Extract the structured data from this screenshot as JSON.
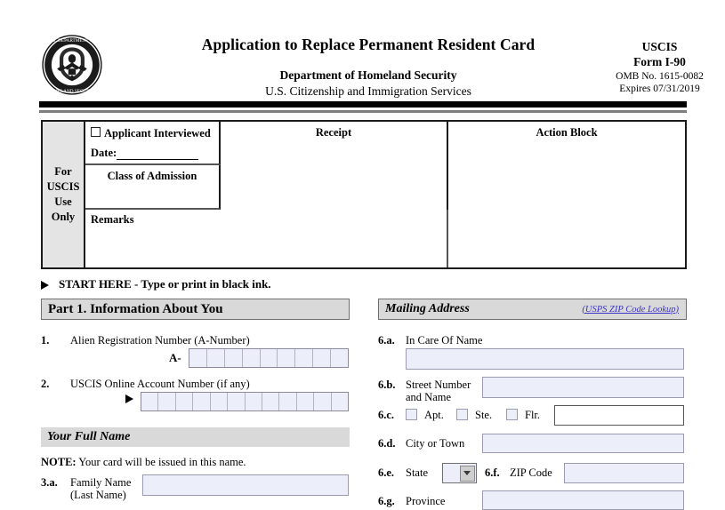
{
  "header": {
    "seal_alt": "Department of Homeland Security seal",
    "main_title": "Application to Replace Permanent Resident Card",
    "department": "Department of Homeland Security",
    "agency_line": "U.S. Citizenship and Immigration Services",
    "agency_short": "USCIS",
    "form_number": "Form I-90",
    "omb": "OMB No. 1615-0082",
    "expires": "Expires 07/31/2019"
  },
  "uscis_use": {
    "side_label": "For\nUSCIS\nUse\nOnly",
    "side_label_lines": [
      "For",
      "USCIS",
      "Use",
      "Only"
    ],
    "applicant_interviewed": "Applicant Interviewed",
    "date_label": "Date:",
    "class_of_admission": "Class of Admission",
    "remarks": "Remarks",
    "receipt": "Receipt",
    "action_block": "Action Block"
  },
  "start_here": "START HERE - Type or print in black ink.",
  "part1": {
    "bar_title": "Part 1.  Information About You",
    "q1": {
      "number": "1.",
      "label": "Alien Registration Number (A-Number)",
      "prefix": "A-",
      "cells": 9,
      "value": ""
    },
    "q2": {
      "number": "2.",
      "label": "USCIS Online Account Number (if any)",
      "cells": 12,
      "value": ""
    },
    "full_name_bar": "Your Full Name",
    "note_bold": "NOTE:",
    "note_text": "Your card will be issued in this name.",
    "q3a": {
      "number": "3.a.",
      "label_line1": "Family Name",
      "label_line2": "(Last Name)",
      "value": ""
    }
  },
  "mailing": {
    "bar_title": "Mailing Address",
    "zip_lookup": "(USPS ZIP Code Lookup)",
    "q6a": {
      "number": "6.a.",
      "label": "In Care Of Name",
      "value": ""
    },
    "q6b": {
      "number": "6.b.",
      "label_line1": "Street Number",
      "label_line2": "and Name",
      "value": ""
    },
    "q6c": {
      "number": "6.c.",
      "options": [
        "Apt.",
        "Ste.",
        "Flr."
      ],
      "checked": [
        false,
        false,
        false
      ],
      "value": ""
    },
    "q6d": {
      "number": "6.d.",
      "label": "City or Town",
      "value": ""
    },
    "q6e": {
      "number": "6.e.",
      "label": "State",
      "value": ""
    },
    "q6f": {
      "number": "6.f.",
      "label": "ZIP Code",
      "value": ""
    },
    "q6g": {
      "number": "6.g.",
      "label": "Province",
      "value": ""
    }
  },
  "colors": {
    "field_fill": "#eceefa",
    "bar_fill": "#d9d9d9",
    "side_label_fill": "#e4e4e4",
    "link": "#3b32c8",
    "rule_black": "#000000",
    "rule_gray": "#7d7d7d"
  }
}
